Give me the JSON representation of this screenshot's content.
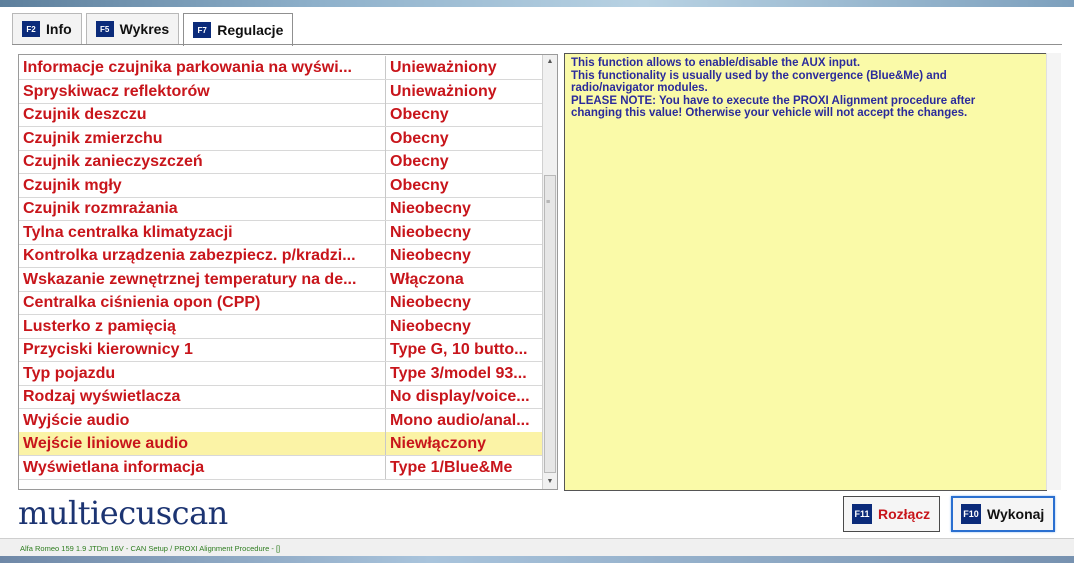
{
  "tabs": [
    {
      "key": "F2",
      "label": "Info"
    },
    {
      "key": "F5",
      "label": "Wykres"
    },
    {
      "key": "F7",
      "label": "Regulacje"
    }
  ],
  "rows": [
    {
      "name": "Informacje czujnika parkowania na wyświ...",
      "value": "Unieważniony"
    },
    {
      "name": "Spryskiwacz reflektorów",
      "value": "Unieważniony"
    },
    {
      "name": "Czujnik deszczu",
      "value": "Obecny"
    },
    {
      "name": "Czujnik zmierzchu",
      "value": "Obecny"
    },
    {
      "name": "Czujnik zanieczyszczeń",
      "value": "Obecny"
    },
    {
      "name": "Czujnik mgły",
      "value": "Obecny"
    },
    {
      "name": "Czujnik rozmrażania",
      "value": "Nieobecny"
    },
    {
      "name": "Tylna centralka klimatyzacji",
      "value": "Nieobecny"
    },
    {
      "name": "Kontrolka urządzenia zabezpiecz. p/kradzi...",
      "value": "Nieobecny"
    },
    {
      "name": "Wskazanie zewnętrznej temperatury na de...",
      "value": "Włączona"
    },
    {
      "name": "Centralka ciśnienia opon (CPP)",
      "value": "Nieobecny"
    },
    {
      "name": "Lusterko z pamięcią",
      "value": "Nieobecny"
    },
    {
      "name": "Przyciski kierownicy 1",
      "value": "Type G, 10 butto..."
    },
    {
      "name": "Typ pojazdu",
      "value": "Type 3/model 93..."
    },
    {
      "name": "Rodzaj wyświetlacza",
      "value": "No display/voice..."
    },
    {
      "name": "Wyjście audio",
      "value": "Mono audio/anal..."
    },
    {
      "name": "Wejście liniowe audio",
      "value": "Niewłączony"
    },
    {
      "name": "Wyświetlana informacja",
      "value": "Type 1/Blue&Me"
    }
  ],
  "selected_row": "Wejście liniowe audio",
  "description": {
    "lines": [
      "This function allows to enable/disable the AUX input.",
      "This functionality is usually used by the convergence (Blue&Me) and",
      "radio/navigator modules.",
      "PLEASE NOTE: You have to execute the PROXI Alignment procedure after",
      "changing this value! Otherwise your vehicle will not accept the changes."
    ]
  },
  "logo": "multiecuscan",
  "buttons": {
    "disconnect": {
      "key": "F11",
      "label": "Rozłącz"
    },
    "execute": {
      "key": "F10",
      "label": "Wykonaj"
    }
  },
  "status": "Alfa Romeo 159 1.9 JTDm 16V - CAN Setup / PROXI Alignment Procedure - []",
  "colors": {
    "row_text": "#c8151b",
    "description_bg": "#fafaa8",
    "description_text": "#2b2b9b",
    "selected_row_bg": "#fbf3a6",
    "fkey_badge": "#0b2b7a",
    "logo": "#1c3472"
  }
}
